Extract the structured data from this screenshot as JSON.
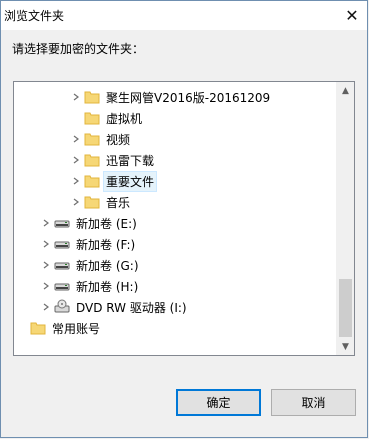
{
  "dialog": {
    "title": "浏览文件夹",
    "prompt": "请选择要加密的文件夹："
  },
  "tree": {
    "items": [
      {
        "label": "聚生网管V2016版-20161209",
        "type": "folder",
        "expandable": true,
        "selected": false
      },
      {
        "label": "虚拟机",
        "type": "folder",
        "expandable": false,
        "selected": false
      },
      {
        "label": "视频",
        "type": "folder",
        "expandable": true,
        "selected": false
      },
      {
        "label": "迅雷下载",
        "type": "folder",
        "expandable": true,
        "selected": false
      },
      {
        "label": "重要文件",
        "type": "folder",
        "expandable": true,
        "selected": true
      },
      {
        "label": "音乐",
        "type": "folder",
        "expandable": true,
        "selected": false
      },
      {
        "label": "新加卷 (E:)",
        "type": "drive",
        "expandable": true,
        "selected": false
      },
      {
        "label": "新加卷 (F:)",
        "type": "drive",
        "expandable": true,
        "selected": false
      },
      {
        "label": "新加卷 (G:)",
        "type": "drive",
        "expandable": true,
        "selected": false
      },
      {
        "label": "新加卷 (H:)",
        "type": "drive",
        "expandable": true,
        "selected": false
      },
      {
        "label": "DVD RW 驱动器 (I:)",
        "type": "dvd",
        "expandable": true,
        "selected": false
      },
      {
        "label": "常用账号",
        "type": "folder",
        "expandable": false,
        "selected": false
      }
    ]
  },
  "buttons": {
    "ok": "确定",
    "cancel": "取消"
  },
  "colors": {
    "folder": "#f6d776",
    "folder_dark": "#e2b43c",
    "selection": "#e5f3fb",
    "primary_border": "#0078d7"
  },
  "icons": {
    "close": "close-icon",
    "expand": "chevron-right-icon",
    "scroll_up": "scroll-up-arrow-icon",
    "scroll_down": "scroll-down-arrow-icon"
  }
}
